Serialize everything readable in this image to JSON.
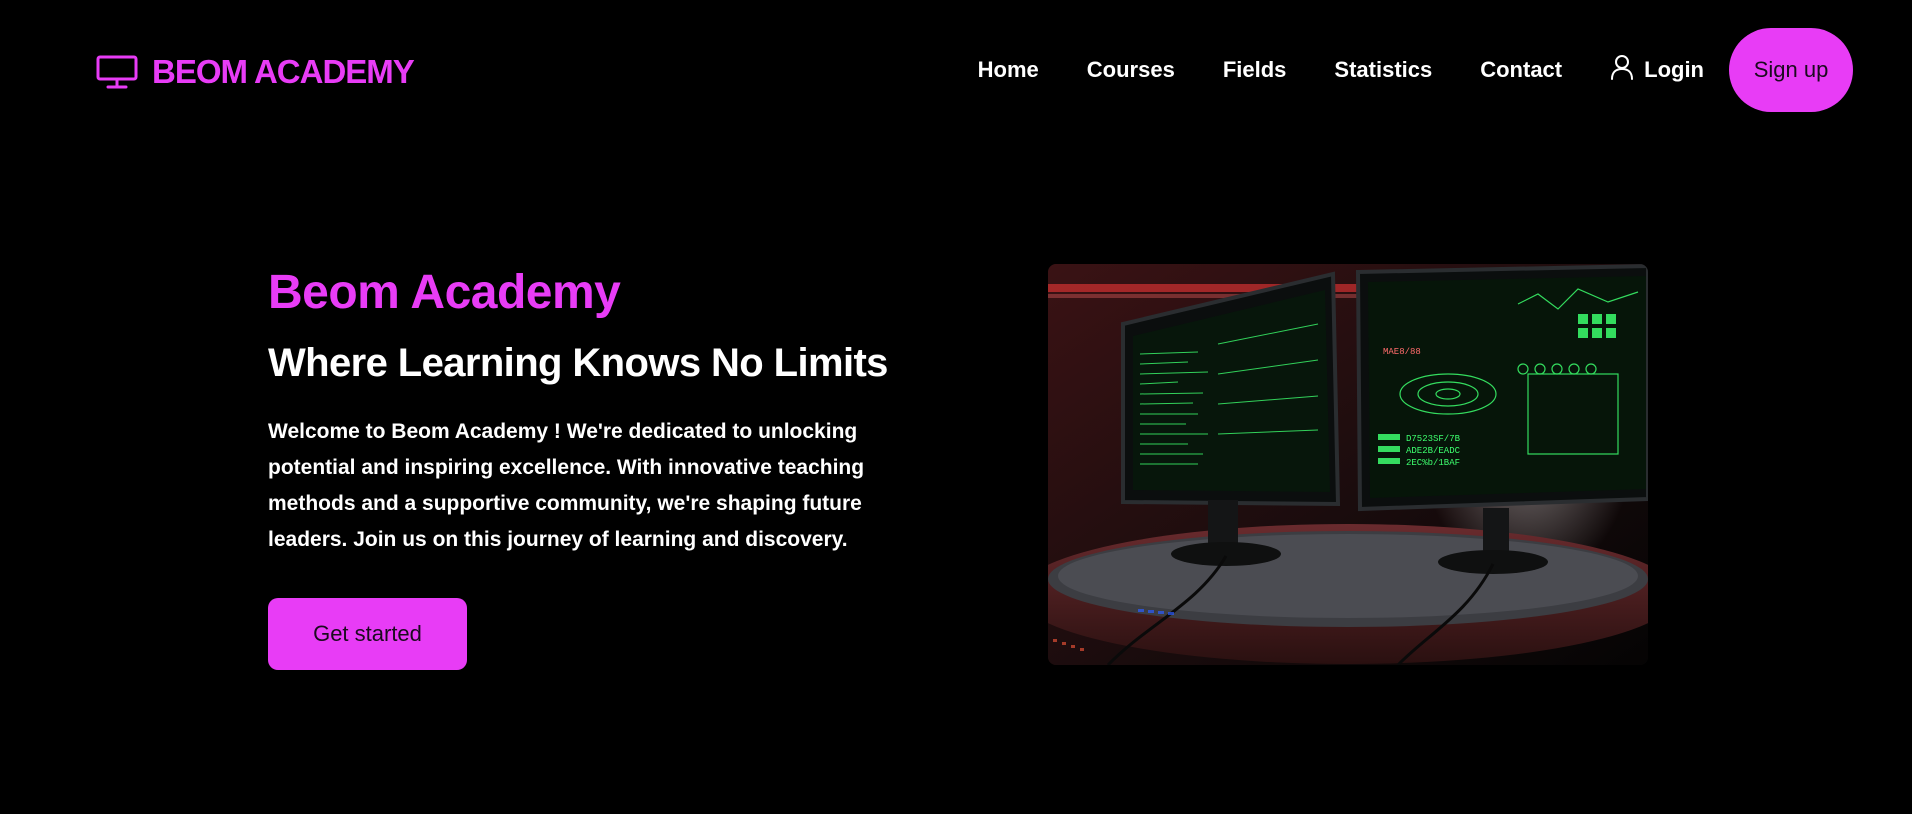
{
  "header": {
    "brand_name": "BEOM ACADEMY",
    "brand_icon": "monitor-icon",
    "nav": {
      "home": "Home",
      "courses": "Courses",
      "fields": "Fields",
      "statistics": "Statistics",
      "contact": "Contact",
      "login": "Login",
      "login_icon": "user-icon",
      "signup": "Sign up"
    }
  },
  "hero": {
    "title": "Beom Academy",
    "subtitle": "Where Learning Knows No Limits",
    "description": "Welcome to Beom Academy ! We're dedicated to unlocking potential and inspiring excellence. With innovative teaching methods and a supportive community, we're shaping future leaders. Join us on this journey of learning and discovery.",
    "cta_label": "Get started",
    "image": {
      "subject": "two computer monitors with green terminal screens on a round desk under red lighting",
      "screen_text": [
        "MAE8/88",
        "D7523SF/7B",
        "ADE2B/EADC",
        "2EC%b/1BAF"
      ]
    }
  },
  "colors": {
    "background": "#000000",
    "accent": "#e83cf6",
    "text": "#ffffff",
    "button_text": "#1b0b1e",
    "terminal_green": "#3dff6e"
  }
}
